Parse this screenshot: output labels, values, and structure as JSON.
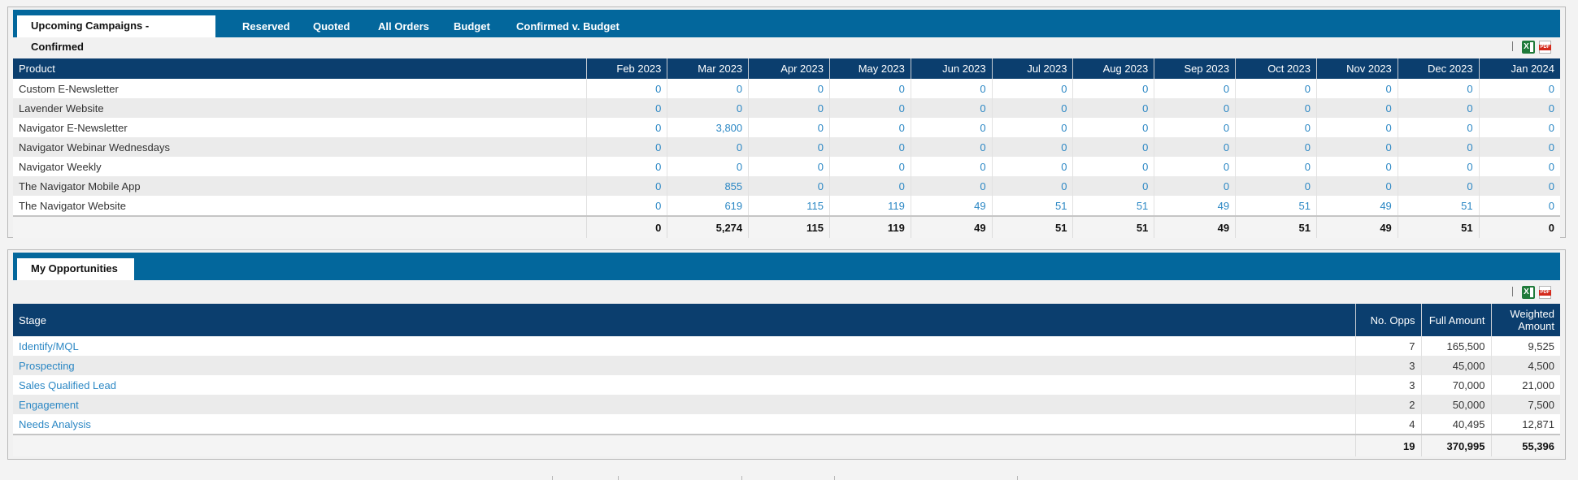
{
  "campaigns": {
    "tabs": [
      {
        "label": "Upcoming Campaigns - Confirmed",
        "active": true
      },
      {
        "label": "Reserved"
      },
      {
        "label": "Quoted"
      },
      {
        "label": "All Orders"
      },
      {
        "label": "Budget"
      },
      {
        "label": "Confirmed v. Budget"
      }
    ],
    "export_icons": [
      "excel-icon",
      "pdf-icon"
    ],
    "columns": [
      "Product",
      "Feb 2023",
      "Mar 2023",
      "Apr 2023",
      "May 2023",
      "Jun 2023",
      "Jul 2023",
      "Aug 2023",
      "Sep 2023",
      "Oct 2023",
      "Nov 2023",
      "Dec 2023",
      "Jan 2024"
    ],
    "rows": [
      {
        "product": "Custom E-Newsletter",
        "values": [
          "0",
          "0",
          "0",
          "0",
          "0",
          "0",
          "0",
          "0",
          "0",
          "0",
          "0",
          "0"
        ]
      },
      {
        "product": "Lavender Website",
        "values": [
          "0",
          "0",
          "0",
          "0",
          "0",
          "0",
          "0",
          "0",
          "0",
          "0",
          "0",
          "0"
        ]
      },
      {
        "product": "Navigator E-Newsletter",
        "values": [
          "0",
          "3,800",
          "0",
          "0",
          "0",
          "0",
          "0",
          "0",
          "0",
          "0",
          "0",
          "0"
        ]
      },
      {
        "product": "Navigator Webinar Wednesdays",
        "values": [
          "0",
          "0",
          "0",
          "0",
          "0",
          "0",
          "0",
          "0",
          "0",
          "0",
          "0",
          "0"
        ]
      },
      {
        "product": "Navigator Weekly",
        "values": [
          "0",
          "0",
          "0",
          "0",
          "0",
          "0",
          "0",
          "0",
          "0",
          "0",
          "0",
          "0"
        ]
      },
      {
        "product": "The Navigator Mobile App",
        "values": [
          "0",
          "855",
          "0",
          "0",
          "0",
          "0",
          "0",
          "0",
          "0",
          "0",
          "0",
          "0"
        ]
      },
      {
        "product": "The Navigator Website",
        "values": [
          "0",
          "619",
          "115",
          "119",
          "49",
          "51",
          "51",
          "49",
          "51",
          "49",
          "51",
          "0"
        ]
      }
    ],
    "totals": [
      "0",
      "5,274",
      "115",
      "119",
      "49",
      "51",
      "51",
      "49",
      "51",
      "49",
      "51",
      "0"
    ]
  },
  "opportunities": {
    "tabs": [
      {
        "label": "My Opportunities",
        "active": true
      }
    ],
    "export_icons": [
      "excel-icon",
      "pdf-icon"
    ],
    "columns": {
      "stage": "Stage",
      "no_opps": "No. Opps",
      "full_amount": "Full Amount",
      "weighted_amount_1": "Weighted",
      "weighted_amount_2": "Amount"
    },
    "rows": [
      {
        "stage": "Identify/MQL",
        "no_opps": "7",
        "full_amount": "165,500",
        "weighted_amount": "9,525"
      },
      {
        "stage": "Prospecting",
        "no_opps": "3",
        "full_amount": "45,000",
        "weighted_amount": "4,500"
      },
      {
        "stage": "Sales Qualified Lead",
        "no_opps": "3",
        "full_amount": "70,000",
        "weighted_amount": "21,000"
      },
      {
        "stage": "Engagement",
        "no_opps": "2",
        "full_amount": "50,000",
        "weighted_amount": "7,500"
      },
      {
        "stage": "Needs Analysis",
        "no_opps": "4",
        "full_amount": "40,495",
        "weighted_amount": "12,871"
      }
    ],
    "totals": {
      "no_opps": "19",
      "full_amount": "370,995",
      "weighted_amount": "55,396"
    }
  },
  "colors": {
    "tabbar": "#03679c",
    "table_header": "#0b3e6e",
    "link": "#2b87c4"
  }
}
